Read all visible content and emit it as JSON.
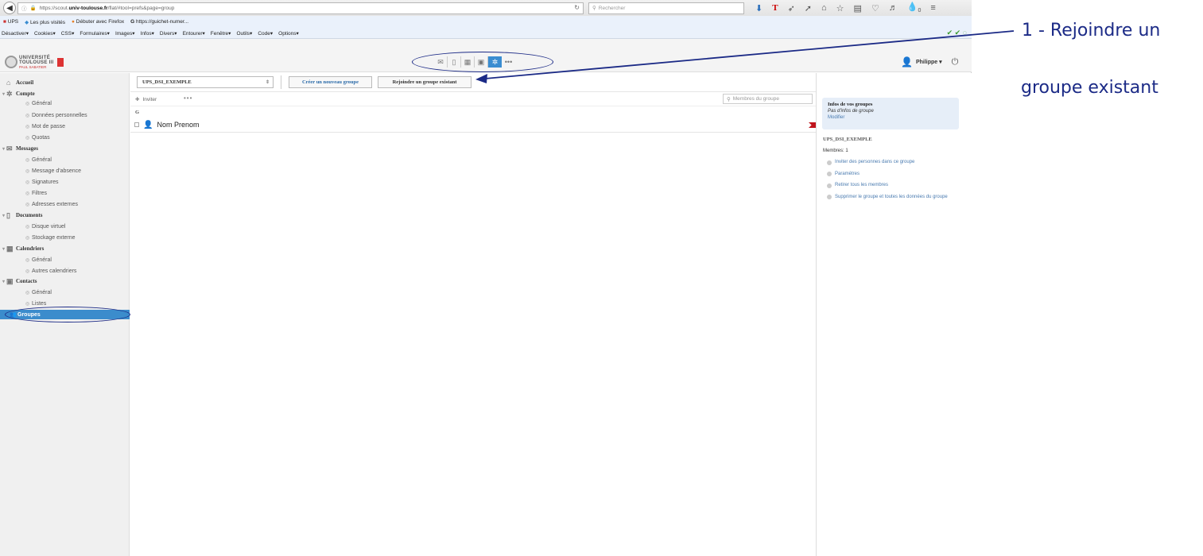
{
  "browser": {
    "url_prefix": "https://scout.",
    "url_domain": "univ-toulouse.fr",
    "url_path": "/flat/#tool=prefs&page=group",
    "search_placeholder": "Rechercher",
    "bookmarks": [
      "UPS",
      "Les plus visités",
      "Débuter avec Firefox",
      "https://guichet-numer..."
    ],
    "devtools": [
      "Désactiver▾",
      "Cookies▾",
      "CSS▾",
      "Formulaires▾",
      "Images▾",
      "Infos▾",
      "Divers▾",
      "Entourer▾",
      "Fenêtre▾",
      "Outils▾",
      "Code▾",
      "Options▾"
    ],
    "toolbar_badge": "0"
  },
  "header": {
    "logo_line1": "UNIVERSITÉ",
    "logo_line2": "TOULOUSE III",
    "logo_line3": "PAUL SABATIER",
    "user": "Philippe ▾",
    "more_dots": "•••"
  },
  "sidebar": {
    "accueil": "Accueil",
    "compte": "Compte",
    "compte_items": [
      "Général",
      "Données personnelles",
      "Mot de passe",
      "Quotas"
    ],
    "messages": "Messages",
    "messages_items": [
      "Général",
      "Message d'absence",
      "Signatures",
      "Filtres",
      "Adresses externes"
    ],
    "documents": "Documents",
    "documents_items": [
      "Disque virtuel",
      "Stockage externe"
    ],
    "calendriers": "Calendriers",
    "calendriers_items": [
      "Général",
      "Autres calendriers"
    ],
    "contacts": "Contacts",
    "contacts_items": [
      "Général",
      "Listes"
    ],
    "groupes": "Groupes"
  },
  "main": {
    "group_select": "UPS_DSI_EXEMPLE",
    "create_button": "Créer un nouveau groupe",
    "join_button": "Rejoindre un groupe existant",
    "invite": "Inviter",
    "more": "•••",
    "members_search_placeholder": "Membres du groupe",
    "letter": "G",
    "member_name": "Nom Prenom"
  },
  "right": {
    "info_title": "Infos de vos groupes",
    "info_text": "Pas d'infos de groupe",
    "info_link": "Modifier",
    "group_name": "UPS_DSI_EXEMPLE",
    "members_count": "Membres: 1",
    "actions": [
      "Inviter des personnes dans ce groupe",
      "Paramètres",
      "Retirer tous les membres",
      "Supprimer le groupe et toutes les données du groupe"
    ]
  },
  "annotation": {
    "line1": "1 - Rejoindre un",
    "line2": "groupe existant",
    "color": "#1b2a86"
  }
}
